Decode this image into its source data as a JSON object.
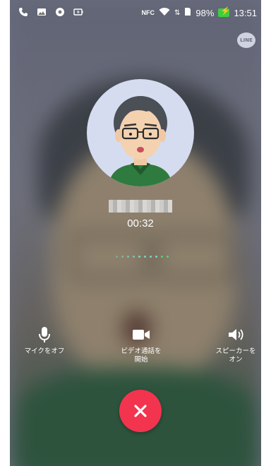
{
  "status_bar": {
    "battery": "98%",
    "time": "13:51",
    "nfc_label": "NFC"
  },
  "app": {
    "logo_text": "LINE"
  },
  "call": {
    "timer": "00:32"
  },
  "controls": {
    "mute_label": "マイクをオフ",
    "video_label": "ビデオ通話を\n開始",
    "speaker_label": "スピーカーを\nオン"
  }
}
